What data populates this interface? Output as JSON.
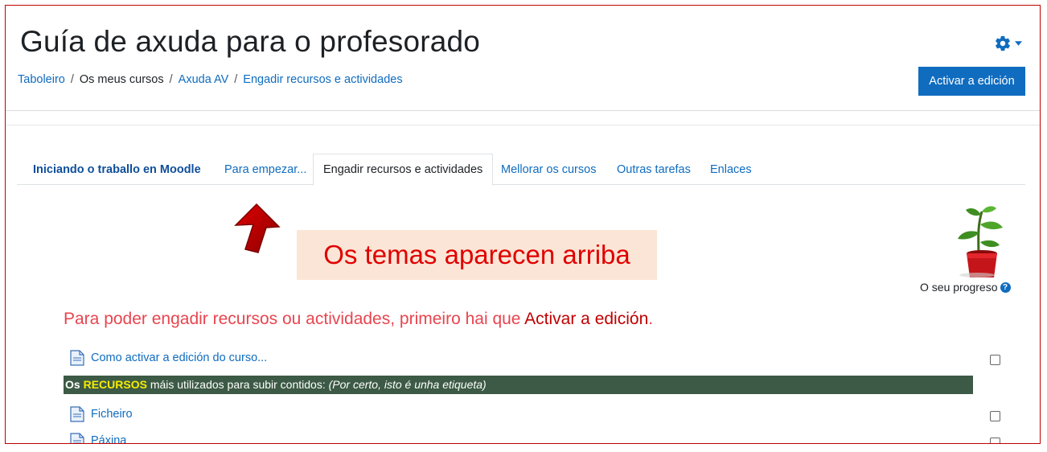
{
  "header": {
    "title": "Guía de axuda para o profesorado",
    "settings_icon": "gear-icon",
    "edit_button": "Activar a edición"
  },
  "breadcrumb": [
    {
      "label": "Taboleiro",
      "link": true
    },
    {
      "label": "Os meus cursos",
      "link": false
    },
    {
      "label": "Axuda AV",
      "link": true
    },
    {
      "label": "Engadir recursos e actividades",
      "link": true
    }
  ],
  "tabs": [
    {
      "label": "Iniciando o traballo en Moodle",
      "state": "bold"
    },
    {
      "label": "Para empezar...",
      "state": "normal"
    },
    {
      "label": "Engadir recursos e actividades",
      "state": "active"
    },
    {
      "label": "Mellorar os cursos",
      "state": "normal"
    },
    {
      "label": "Outras tarefas",
      "state": "normal"
    },
    {
      "label": "Enlaces",
      "state": "normal"
    }
  ],
  "annotation": {
    "callout": "Os temas aparecen arriba",
    "arrow_icon": "red-up-arrow-icon"
  },
  "progress": {
    "label": "O seu progreso",
    "image": "plant-pot-icon",
    "help_icon": "question-circle-icon"
  },
  "notice": {
    "prefix": "Para poder engadir recursos ou actividades, primeiro hai que ",
    "emphasis": "Activar a edición",
    "suffix": "."
  },
  "activities": [
    {
      "name": "Como activar a edición do curso..."
    },
    {
      "name": "Ficheiro"
    },
    {
      "name": "Páxina"
    }
  ],
  "label_bar": {
    "part1": "Os ",
    "part2": "RECURSOS",
    "part3": " máis utilizados para subir contidos: ",
    "part4": "(Por certo, isto é unha etiqueta)"
  },
  "colors": {
    "primary": "#0f6cbf",
    "label_bg": "#3c5a45",
    "highlight": "#f5ec00",
    "callout_bg": "#fbe5d6",
    "alert_red": "#e00000"
  }
}
